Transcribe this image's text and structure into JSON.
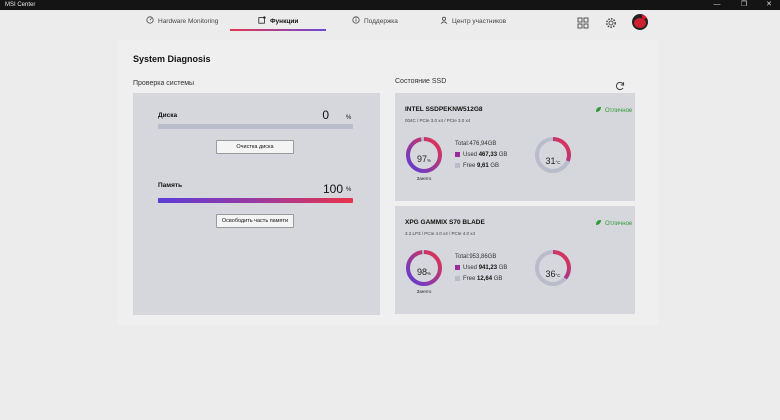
{
  "window": {
    "title": "MSI Center",
    "controls": [
      "—",
      "❐",
      "✕"
    ]
  },
  "nav": {
    "tabs": [
      {
        "label": "Hardware Monitoring",
        "icon": "gauge-icon",
        "active": false
      },
      {
        "label": "Функции",
        "icon": "features-icon",
        "active": true
      },
      {
        "label": "Поддержка",
        "icon": "support-icon",
        "active": false
      },
      {
        "label": "Центр участников",
        "icon": "user-icon",
        "active": false
      }
    ],
    "icons": [
      "grid-icon",
      "gear-icon",
      "avatar"
    ]
  },
  "page": {
    "title": "System Diagnosis",
    "left_section_title": "Проверка системы",
    "right_section_title": "Состояние SSD"
  },
  "system_check": {
    "disk": {
      "label": "Диска",
      "value": "0",
      "unit": "%",
      "fill": 0,
      "button": "Очистка диска"
    },
    "memory": {
      "label": "Память",
      "value": "100",
      "unit": "%",
      "fill": 1,
      "button": "Освободить часть памяти"
    }
  },
  "ssd": [
    {
      "name": "INTEL SSDPEKNW512G8",
      "spec": "004C / PCIe 3.0 x4 / PCIe 3.0 x4",
      "status": "Отличное",
      "usage_pct": "97",
      "usage_unit": "%",
      "usage_caption": "Занято",
      "usage_fraction": 0.97,
      "total": "Total:476,94GB",
      "used_label": "Used",
      "used_value": "467,33",
      "used_unit": "GB",
      "free_label": "Free",
      "free_value": "9,61",
      "free_unit": "GB",
      "temp": "31",
      "temp_unit": "°C",
      "temp_fraction": 0.31
    },
    {
      "name": "XPG GAMMIX S70 BLADE",
      "spec": "3.2.LP3 / PCIe 4.0 x4 / PCIe 4.0 x4",
      "status": "Отличное",
      "usage_pct": "98",
      "usage_unit": "%",
      "usage_caption": "Занято",
      "usage_fraction": 0.98,
      "total": "Total:953,86GB",
      "used_label": "Used",
      "used_value": "941,23",
      "used_unit": "GB",
      "free_label": "Free",
      "free_value": "12,64",
      "free_unit": "GB",
      "temp": "36",
      "temp_unit": "°C",
      "temp_fraction": 0.36
    }
  ],
  "colors": {
    "accent_start": "#5a3cd8",
    "accent_end": "#e8334a",
    "status_ok": "#2f9a37",
    "used_marker": "#9b2a9a",
    "free_marker": "#b9bccb"
  }
}
